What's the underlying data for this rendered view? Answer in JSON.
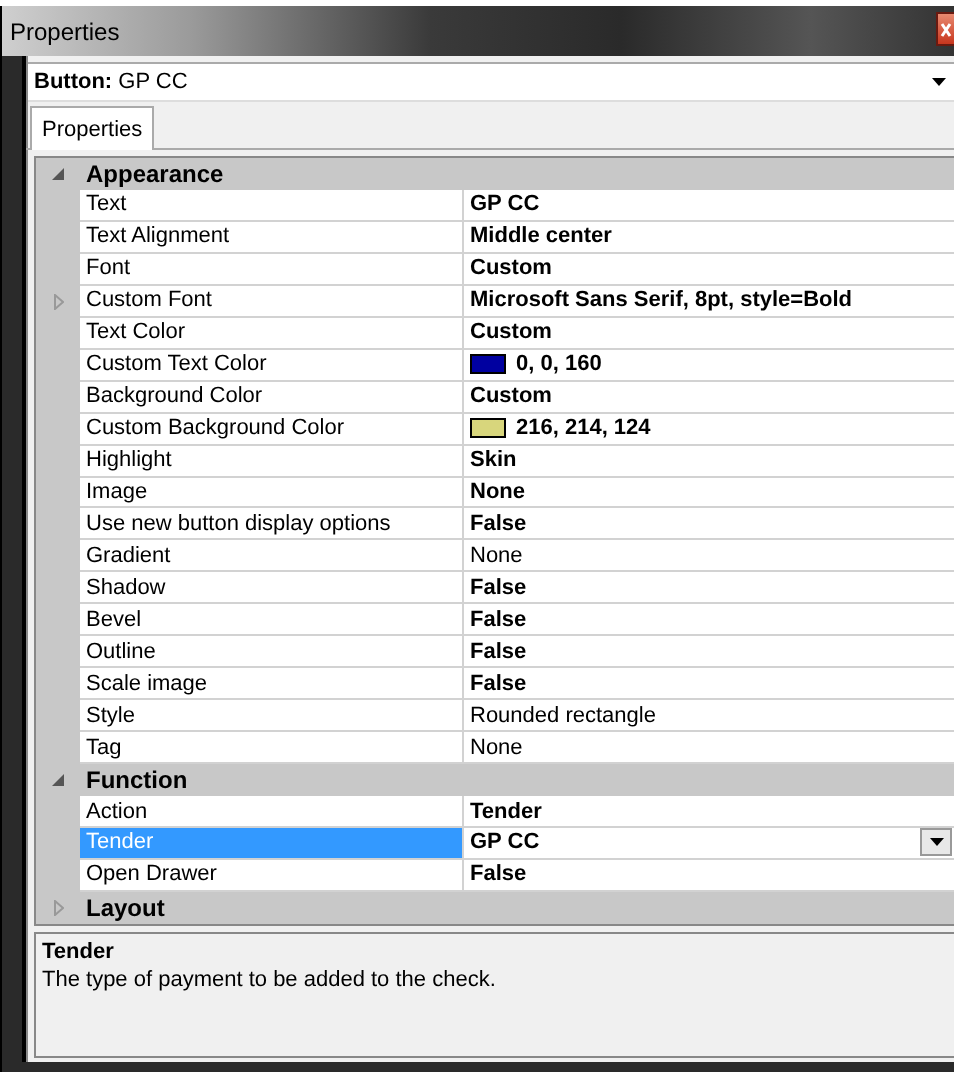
{
  "window": {
    "title": "Properties"
  },
  "object_selector": {
    "label": "Button:",
    "value": "GP CC"
  },
  "tabs": [
    {
      "label": "Properties",
      "selected": true
    }
  ],
  "categories": [
    {
      "name": "Appearance",
      "expanded": true,
      "properties": [
        {
          "name": "Text",
          "value": "GP CC",
          "kind": "text",
          "bold": true,
          "selected": false
        },
        {
          "name": "Text Alignment",
          "value": "Middle center",
          "kind": "text",
          "bold": true,
          "selected": false
        },
        {
          "name": "Font",
          "value": "Custom",
          "kind": "text",
          "bold": true,
          "selected": false
        },
        {
          "name": "Custom Font",
          "value": "Microsoft Sans Serif, 8pt, style=Bold",
          "kind": "group",
          "bold": true,
          "selected": false
        },
        {
          "name": "Text Color",
          "value": "Custom",
          "kind": "text",
          "bold": true,
          "selected": false
        },
        {
          "name": "Custom Text Color",
          "value": "0, 0, 160",
          "kind": "color",
          "color": "#0000a0",
          "bold": true,
          "selected": false
        },
        {
          "name": "Background Color",
          "value": "Custom",
          "kind": "text",
          "bold": true,
          "selected": false
        },
        {
          "name": "Custom Background Color",
          "value": "216, 214, 124",
          "kind": "color",
          "color": "#d8d67c",
          "bold": true,
          "selected": false
        },
        {
          "name": "Highlight",
          "value": "Skin",
          "kind": "text",
          "bold": true,
          "selected": false
        },
        {
          "name": "Image",
          "value": "None",
          "kind": "text",
          "bold": true,
          "selected": false
        },
        {
          "name": "Use new button display options",
          "value": "False",
          "kind": "text",
          "bold": true,
          "selected": false
        },
        {
          "name": "Gradient",
          "value": "None",
          "kind": "text",
          "bold": false,
          "selected": false
        },
        {
          "name": "Shadow",
          "value": "False",
          "kind": "text",
          "bold": true,
          "selected": false
        },
        {
          "name": "Bevel",
          "value": "False",
          "kind": "text",
          "bold": true,
          "selected": false
        },
        {
          "name": "Outline",
          "value": "False",
          "kind": "text",
          "bold": true,
          "selected": false
        },
        {
          "name": "Scale image",
          "value": "False",
          "kind": "text",
          "bold": true,
          "selected": false
        },
        {
          "name": "Style",
          "value": "Rounded rectangle",
          "kind": "text",
          "bold": false,
          "selected": false
        },
        {
          "name": "Tag",
          "value": "None",
          "kind": "text",
          "bold": false,
          "selected": false
        }
      ]
    },
    {
      "name": "Function",
      "expanded": true,
      "properties": [
        {
          "name": "Action",
          "value": "Tender",
          "kind": "text",
          "bold": true,
          "selected": false
        },
        {
          "name": "Tender",
          "value": "GP CC",
          "kind": "text",
          "bold": true,
          "selected": true
        },
        {
          "name": "Open Drawer",
          "value": "False",
          "kind": "text",
          "bold": true,
          "selected": false
        }
      ]
    },
    {
      "name": "Layout",
      "expanded": false
    }
  ],
  "description": {
    "title": "Tender",
    "text": "The type of payment to be added to the check."
  }
}
